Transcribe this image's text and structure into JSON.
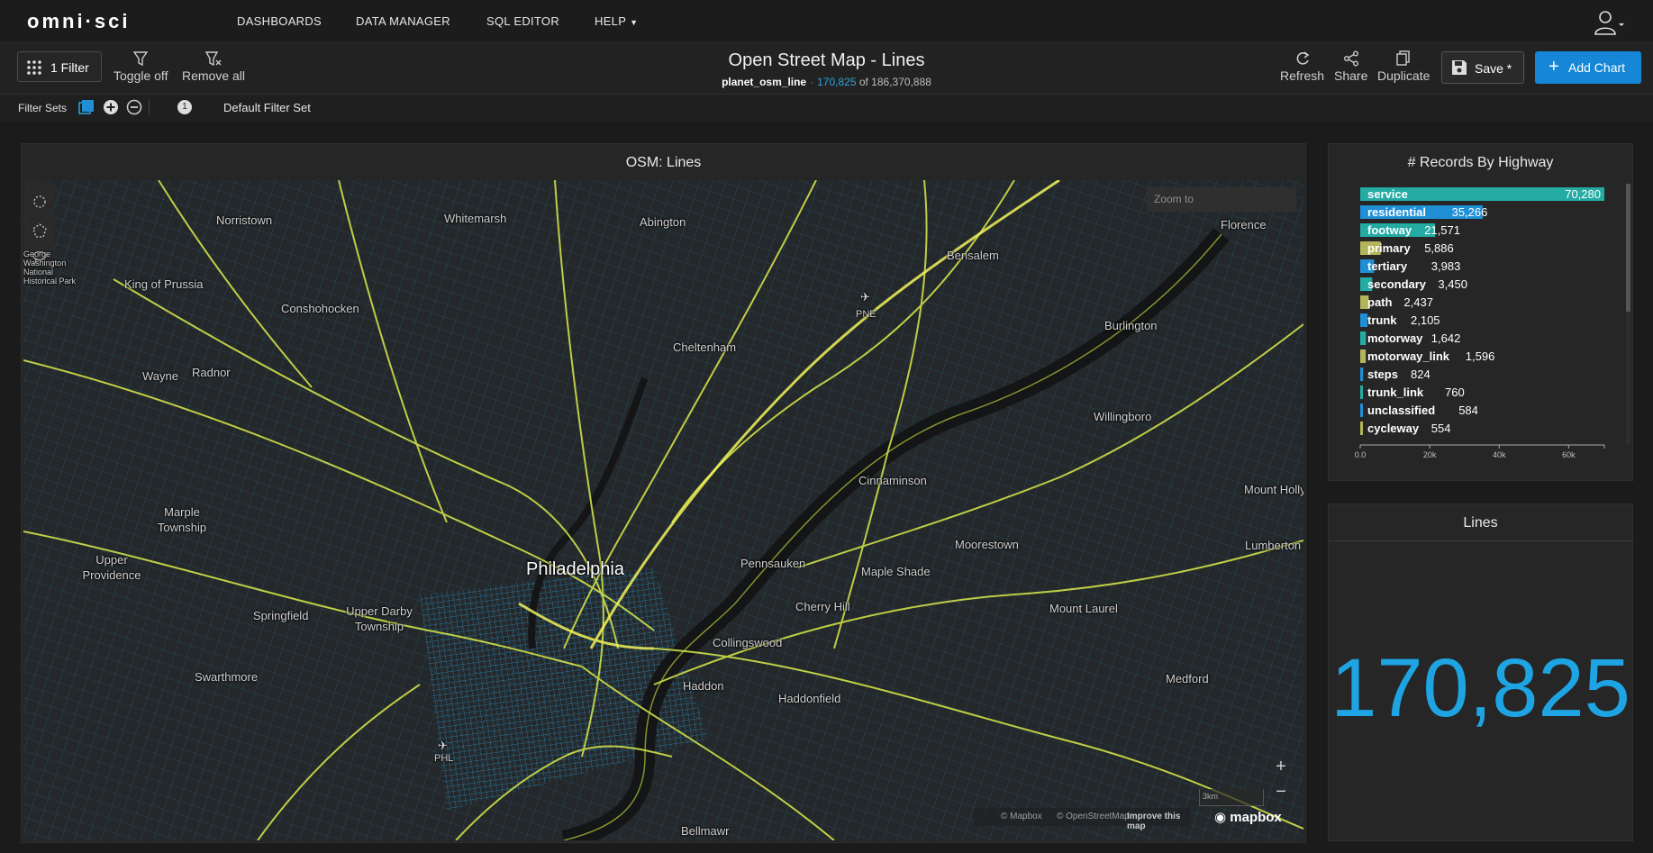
{
  "app": {
    "logo": "omni·sci",
    "nav": [
      "DASHBOARDS",
      "DATA MANAGER",
      "SQL EDITOR",
      "HELP"
    ]
  },
  "dashboard": {
    "title": "Open Street Map - Lines",
    "table": "planet_osm_line",
    "filtered_count": "170,825",
    "of_text": "of 186,370,888",
    "filter_button": "1 Filter",
    "toggle_off": "Toggle off",
    "remove_all": "Remove all",
    "refresh": "Refresh",
    "share": "Share",
    "duplicate": "Duplicate",
    "save": "Save *",
    "add_chart": "Add Chart"
  },
  "filter_sets": {
    "label": "Filter Sets",
    "count": "1",
    "current": "Default Filter Set"
  },
  "map_panel": {
    "title": "OSM: Lines",
    "zoom_placeholder": "Zoom to",
    "scale": "3km",
    "attribution": [
      "© Mapbox",
      "© OpenStreetMap",
      "Improve this map"
    ],
    "mapbox_logo": "mapbox",
    "places": [
      "Norristown",
      "Whitemarsh",
      "Abington",
      "Florence",
      "Bensalem",
      "George Washington National Historical Park",
      "King of Prussia",
      "Conshohocken",
      "PNE",
      "Burlington",
      "Cheltenham",
      "Wayne",
      "Radnor",
      "Willingboro",
      "Cinnaminson",
      "Mount Holly",
      "Marple Township",
      "Moorestown",
      "Lumberton",
      "Upper Providence",
      "Philadelphia",
      "Pennsauken",
      "Maple Shade",
      "Springfield",
      "Upper Darby Township",
      "Cherry Hill",
      "Mount Laurel",
      "Collingswood",
      "Swarthmore",
      "Haddon",
      "Haddonfield",
      "Medford",
      "PHL",
      "Bellmawr"
    ]
  },
  "highway_panel": {
    "title": "# Records By Highway",
    "colors": {
      "teal": "#23aba4",
      "blue": "#1f8fd6",
      "olive": "#b3b55a"
    }
  },
  "number_panel": {
    "title": "Lines",
    "value": "170,825",
    "color": "#1fa4e3"
  },
  "chart_data": {
    "type": "bar",
    "orientation": "horizontal",
    "title": "# Records By Highway",
    "categories": [
      "service",
      "residential",
      "footway",
      "primary",
      "tertiary",
      "secondary",
      "path",
      "trunk",
      "motorway",
      "motorway_link",
      "steps",
      "trunk_link",
      "unclassified",
      "cycleway"
    ],
    "values": [
      70280,
      35266,
      21571,
      5886,
      3983,
      3450,
      2437,
      2105,
      1642,
      1596,
      824,
      760,
      584,
      554
    ],
    "value_labels": [
      "70,280",
      "35,266",
      "21,571",
      "5,886",
      "3,983",
      "3,450",
      "2,437",
      "2,105",
      "1,642",
      "1,596",
      "824",
      "760",
      "584",
      "554"
    ],
    "bar_colors": [
      "#23aba4",
      "#1f8fd6",
      "#23aba4",
      "#b3b55a",
      "#1f8fd6",
      "#23aba4",
      "#b3b55a",
      "#1f8fd6",
      "#23aba4",
      "#b3b55a",
      "#1f8fd6",
      "#23aba4",
      "#1f8fd6",
      "#b3b55a"
    ],
    "xlim": [
      0,
      70280
    ],
    "x_ticks": [
      "0.0",
      "20k",
      "40k",
      "60k"
    ],
    "x_tick_values": [
      0,
      20000,
      40000,
      60000
    ]
  }
}
